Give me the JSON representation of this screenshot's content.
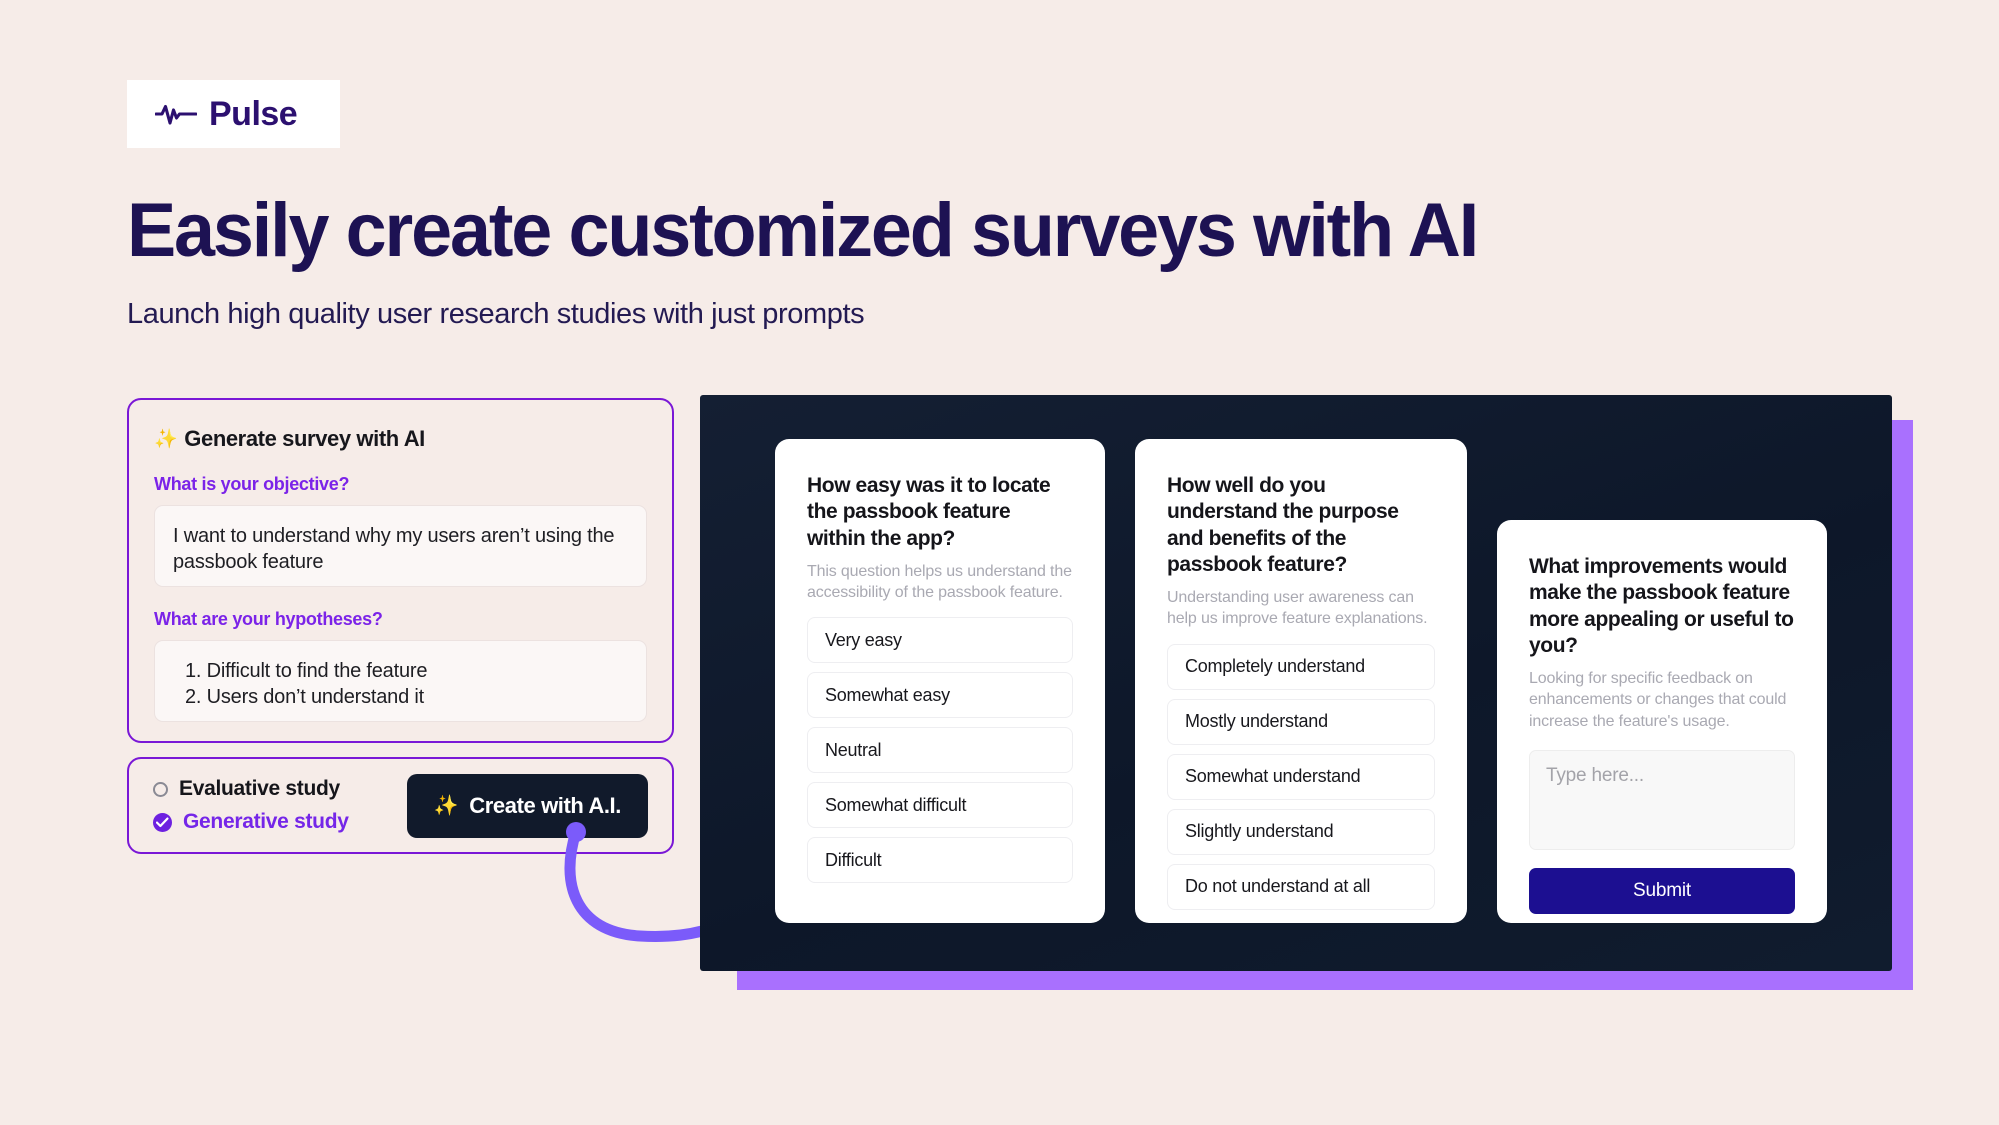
{
  "brand": {
    "name": "Pulse",
    "logo_icon": "pulse-waveform-icon",
    "logo_color": "#2c1070"
  },
  "hero": {
    "headline": "Easily create customized surveys with AI",
    "subheadline": "Launch high quality user research studies with just prompts",
    "headline_color": "#1d1253",
    "background_color": "#f6ece8"
  },
  "generator": {
    "title": "Generate survey with AI",
    "title_icon": "sparkles-icon",
    "objective": {
      "label": "What is your objective?",
      "value": "I want to understand why my users aren’t using the passbook feature"
    },
    "hypotheses": {
      "label": "What are your hypotheses?",
      "lines": [
        "1. Difficult to find the feature",
        "2. Users don’t understand it"
      ]
    },
    "accent_color": "#7b23e8"
  },
  "study_type": {
    "options": [
      {
        "label": "Evaluative study",
        "selected": false
      },
      {
        "label": "Generative study",
        "selected": true
      }
    ],
    "create_button": {
      "label": "Create with A.I.",
      "icon": "sparkles-icon",
      "background": "#111a2b"
    }
  },
  "preview": {
    "panel_background": "#0d1729",
    "accent_block_color": "#a970fe",
    "cards": [
      {
        "question": "How easy was it to locate the passbook feature within the app?",
        "description": "This question helps us understand the accessibility of the passbook feature.",
        "options": [
          "Very easy",
          "Somewhat easy",
          "Neutral",
          "Somewhat difficult",
          "Difficult"
        ]
      },
      {
        "question": "How well do you understand the purpose and benefits of the passbook feature?",
        "description": "Understanding user awareness can help us improve feature explanations.",
        "options": [
          "Completely understand",
          "Mostly understand",
          "Somewhat understand",
          "Slightly understand",
          "Do not understand at all"
        ]
      },
      {
        "question": "What improvements would make the passbook feature more appealing or useful to you?",
        "description": "Looking for specific feedback on enhancements or changes that could increase the feature's usage.",
        "input_placeholder": "Type here...",
        "submit_label": "Submit"
      }
    ]
  },
  "arrow": {
    "name": "curved-flow-arrow",
    "color": "#7b5bfa"
  }
}
